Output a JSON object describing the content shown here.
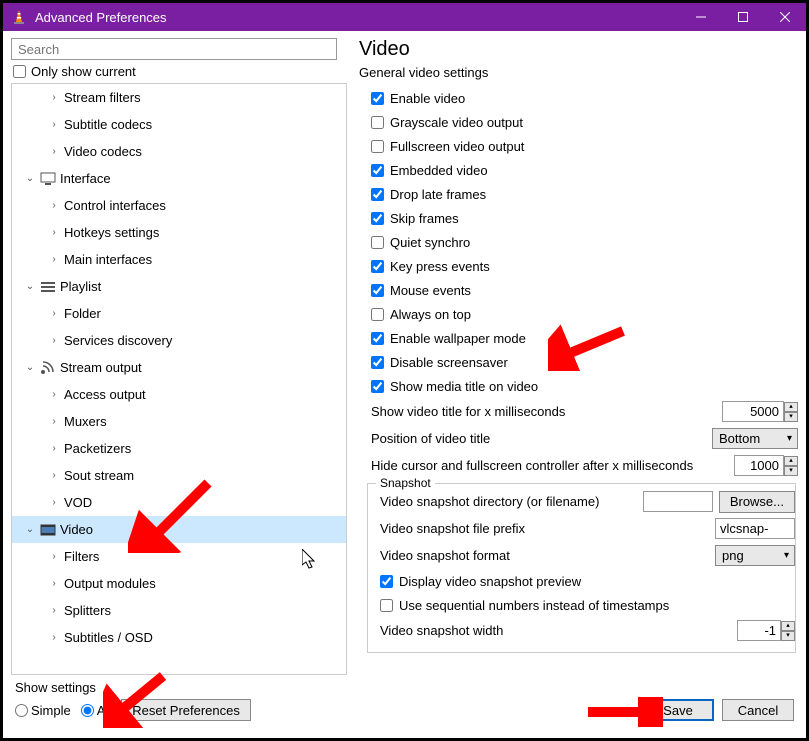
{
  "window": {
    "title": "Advanced Preferences"
  },
  "search": {
    "placeholder": "Search"
  },
  "only_current": "Only show current",
  "tree": [
    {
      "lvl": 2,
      "tw": "›",
      "label": "Stream filters"
    },
    {
      "lvl": 2,
      "tw": "›",
      "label": "Subtitle codecs"
    },
    {
      "lvl": 2,
      "tw": "›",
      "label": "Video codecs"
    },
    {
      "lvl": 1,
      "tw": "⌄",
      "icon": "interface",
      "label": "Interface"
    },
    {
      "lvl": 2,
      "tw": "›",
      "label": "Control interfaces"
    },
    {
      "lvl": 2,
      "tw": "",
      "label": "Hotkeys settings"
    },
    {
      "lvl": 2,
      "tw": "›",
      "label": "Main interfaces"
    },
    {
      "lvl": 1,
      "tw": "⌄",
      "icon": "playlist",
      "label": "Playlist"
    },
    {
      "lvl": 2,
      "tw": "",
      "label": "Folder"
    },
    {
      "lvl": 2,
      "tw": "›",
      "label": "Services discovery"
    },
    {
      "lvl": 1,
      "tw": "⌄",
      "icon": "stream",
      "label": "Stream output"
    },
    {
      "lvl": 2,
      "tw": "›",
      "label": "Access output"
    },
    {
      "lvl": 2,
      "tw": "›",
      "label": "Muxers"
    },
    {
      "lvl": 2,
      "tw": "›",
      "label": "Packetizers"
    },
    {
      "lvl": 2,
      "tw": "›",
      "label": "Sout stream"
    },
    {
      "lvl": 2,
      "tw": "›",
      "label": "VOD"
    },
    {
      "lvl": 1,
      "tw": "⌄",
      "icon": "video",
      "label": "Video",
      "selected": true
    },
    {
      "lvl": 2,
      "tw": "›",
      "label": "Filters"
    },
    {
      "lvl": 2,
      "tw": "›",
      "label": "Output modules"
    },
    {
      "lvl": 2,
      "tw": "›",
      "label": "Splitters"
    },
    {
      "lvl": 2,
      "tw": "›",
      "label": "Subtitles / OSD"
    }
  ],
  "heading": "Video",
  "subheading": "General video settings",
  "checks": [
    {
      "c": true,
      "l": "Enable video"
    },
    {
      "c": false,
      "l": "Grayscale video output"
    },
    {
      "c": false,
      "l": "Fullscreen video output"
    },
    {
      "c": true,
      "l": "Embedded video"
    },
    {
      "c": true,
      "l": "Drop late frames"
    },
    {
      "c": true,
      "l": "Skip frames"
    },
    {
      "c": false,
      "l": "Quiet synchro"
    },
    {
      "c": true,
      "l": "Key press events"
    },
    {
      "c": true,
      "l": "Mouse events"
    },
    {
      "c": false,
      "l": "Always on top"
    },
    {
      "c": true,
      "l": "Enable wallpaper mode"
    },
    {
      "c": true,
      "l": "Disable screensaver"
    },
    {
      "c": true,
      "l": "Show media title on video"
    }
  ],
  "rows": {
    "title_ms": {
      "l": "Show video title for x milliseconds",
      "v": "5000"
    },
    "title_pos": {
      "l": "Position of video title",
      "v": "Bottom"
    },
    "hide_ms": {
      "l": "Hide cursor and fullscreen controller after x milliseconds",
      "v": "1000"
    }
  },
  "snapshot": {
    "legend": "Snapshot",
    "dir": {
      "l": "Video snapshot directory (or filename)",
      "v": "",
      "btn": "Browse..."
    },
    "prefix": {
      "l": "Video snapshot file prefix",
      "v": "vlcsnap-"
    },
    "format": {
      "l": "Video snapshot format",
      "v": "png"
    },
    "preview": {
      "c": true,
      "l": "Display video snapshot preview"
    },
    "seq": {
      "c": false,
      "l": "Use sequential numbers instead of timestamps"
    },
    "width": {
      "l": "Video snapshot width",
      "v": "-1"
    }
  },
  "show_settings": {
    "label": "Show settings",
    "simple": "Simple",
    "all": "All",
    "reset": "Reset Preferences"
  },
  "buttons": {
    "save": "Save",
    "cancel": "Cancel"
  }
}
